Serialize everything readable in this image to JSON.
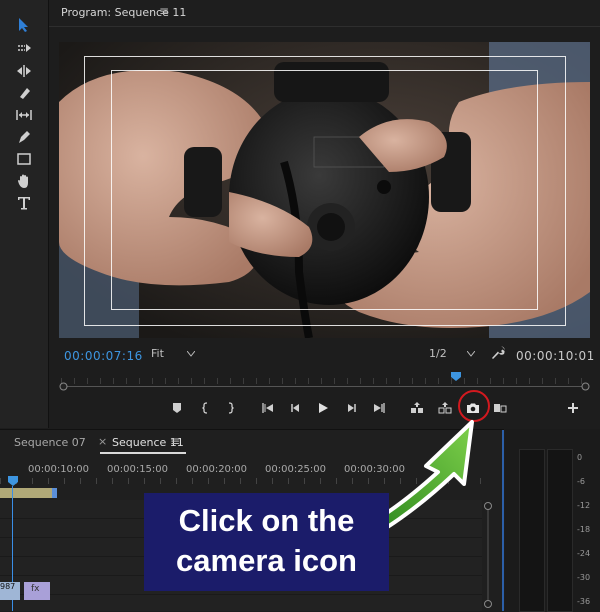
{
  "program": {
    "title": "Program: Sequence 11",
    "menu_glyph": "≡",
    "timecode_current": "00:00:07:16",
    "zoom_select": "Fit",
    "resolution_select": "1/2",
    "timecode_duration": "00:00:10:01"
  },
  "transport": {
    "buttons": [
      "add-marker",
      "mark-in",
      "mark-out",
      "go-to-in",
      "step-back",
      "play",
      "step-forward",
      "go-to-out",
      "lift",
      "extract",
      "export-frame",
      "comparison-view",
      "add"
    ]
  },
  "timeline": {
    "tabs": [
      {
        "label": "Sequence 07"
      },
      {
        "label": "Sequence 11",
        "active": true
      }
    ],
    "close_glyph": "×",
    "menu_glyph": "≡",
    "ruler_labels": [
      "00:00:10:00",
      "00:00:15:00",
      "00:00:20:00",
      "00:00:25:00",
      "00:00:30:00"
    ],
    "clip_a_label": "987",
    "clip_b_label": "fx"
  },
  "meters": {
    "labels": [
      "0",
      "-6",
      "-12",
      "-18",
      "-24",
      "-30",
      "-36"
    ]
  },
  "callout": {
    "line1": "Click on the",
    "line2": "camera icon"
  },
  "colors": {
    "accent_blue": "#3d95e0",
    "callout_bg": "#1b1c6a",
    "highlight_red": "#d2191f",
    "arrow_green": "#3fa02a"
  }
}
